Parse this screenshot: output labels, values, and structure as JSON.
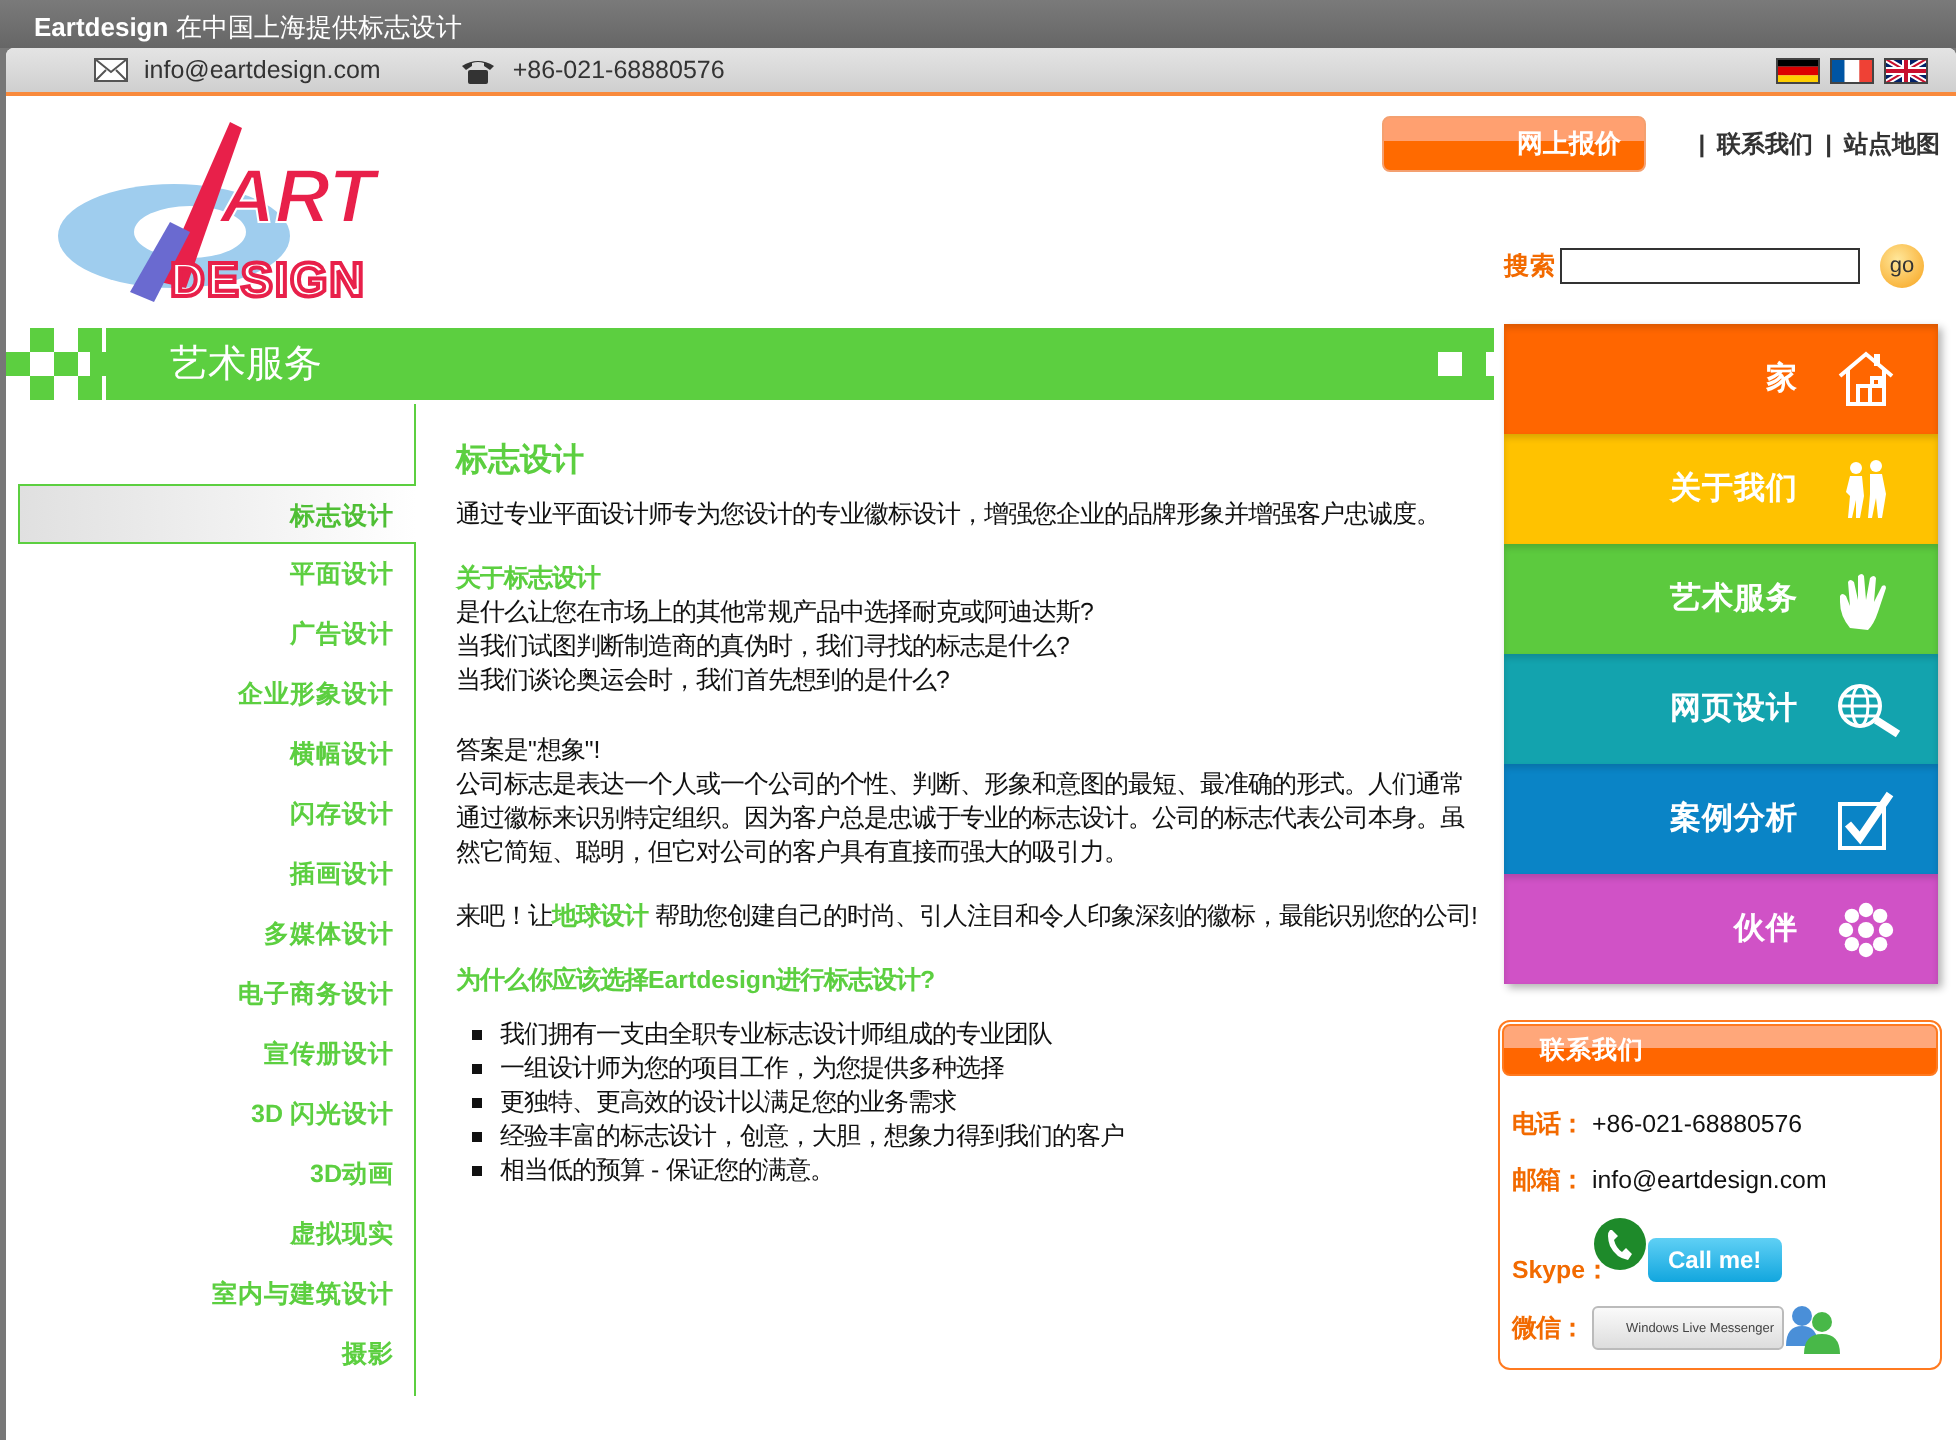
{
  "title_bar": {
    "text": "**Eartdesign** 在中国上海提供标志设计"
  },
  "top_bar": {
    "email": "info@eartdesign.com",
    "phone": "+86-021-68880576"
  },
  "header": {
    "logo": {
      "line_1": "ART",
      "line_2": "DESIGN"
    },
    "quote_button": "网上报价",
    "separators": [
      "|",
      "|"
    ],
    "links": [
      "联系我们",
      "站点地图"
    ],
    "search": {
      "label": "搜索",
      "go": "go"
    }
  },
  "banner": {
    "title": "艺术服务"
  },
  "sidebar": {
    "items": [
      {
        "label": "标志设计",
        "selected": true
      },
      {
        "label": "平面设计",
        "selected": false
      },
      {
        "label": "广告设计",
        "selected": false
      },
      {
        "label": "企业形象设计",
        "selected": false
      },
      {
        "label": "横幅设计",
        "selected": false
      },
      {
        "label": "闪存设计",
        "selected": false
      },
      {
        "label": "插画设计",
        "selected": false
      },
      {
        "label": "多媒体设计",
        "selected": false
      },
      {
        "label": "电子商务设计",
        "selected": false
      },
      {
        "label": "宣传册设计",
        "selected": false
      },
      {
        "label": "3D 闪光设计",
        "selected": false
      },
      {
        "label": "3D动画",
        "selected": false
      },
      {
        "label": "虚拟现实",
        "selected": false
      },
      {
        "label": "室内与建筑设计",
        "selected": false
      },
      {
        "label": "摄影",
        "selected": false
      }
    ]
  },
  "article": {
    "blocks": [
      {
        "kind": "heading",
        "text": "标志设计"
      },
      {
        "kind": "paragraph",
        "text": "通过专业平面设计师专为您设计的专业徽标设计，增强您企业的品牌形象并增强客户忠诚度。"
      },
      {
        "kind": "subheading",
        "text": "关于标志设计"
      },
      {
        "kind": "lines",
        "lines": [
          "是什么让您在市场上的其他常规产品中选择耐克或阿迪达斯?",
          "当我们试图判断制造商的真伪时，我们寻找的标志是什么?",
          "当我们谈论奥运会时，我们首先想到的是什么?"
        ]
      },
      {
        "kind": "lines",
        "lines": [
          "答案是\"想象\"!"
        ]
      },
      {
        "kind": "paragraph",
        "text": "公司标志是表达一个人或一个公司的个性、判断、形象和意图的最短、最准确的形式。人们通常通过徽标来识别特定组织。因为客户总是忠诚于专业的标志设计。公司的标志代表公司本身。虽然它简短、聪明，但它对公司的客户具有直接而强大的吸引力。"
      },
      {
        "kind": "paragraph",
        "text": "来吧！让**地球设计** 帮助您创建自己的时尚、引人注目和令人印象深刻的徽标，最能识别您的公司!"
      },
      {
        "kind": "subheading",
        "text": "为什么你应该选择Eartdesign进行标志设计?"
      },
      {
        "kind": "list",
        "items": [
          "我们拥有一支由全职专业标志设计师组成的专业团队",
          "一组设计师为您的项目工作，为您提供多种选择",
          "更独特、更高效的设计以满足您的业务需求",
          "经验丰富的标志设计，创意，大胆，想象力得到我们的客户",
          "相当低的预算 - 保证您的满意。"
        ]
      }
    ]
  },
  "color_nav": {
    "items": [
      {
        "label": "家",
        "color": "#ff6600"
      },
      {
        "label": "关于我们",
        "color": "#ffc200"
      },
      {
        "label": "艺术服务",
        "color": "#5cca3e"
      },
      {
        "label": "网页设计",
        "color": "#13a3ae"
      },
      {
        "label": "案例分析",
        "color": "#0a84c6"
      },
      {
        "label": "伙伴",
        "color": "#d052c6"
      }
    ]
  },
  "contact": {
    "title": "联系我们",
    "rows": [
      {
        "kind": "text",
        "label": "电话：",
        "value": "+86-021-68880576"
      },
      {
        "kind": "text",
        "label": "邮箱：",
        "value": "info@eartdesign.com"
      },
      {
        "kind": "skype",
        "label": "Skype：",
        "value": "Call me!"
      },
      {
        "kind": "messenger",
        "label": "微信：",
        "value": "Windows Live Messenger"
      }
    ]
  }
}
